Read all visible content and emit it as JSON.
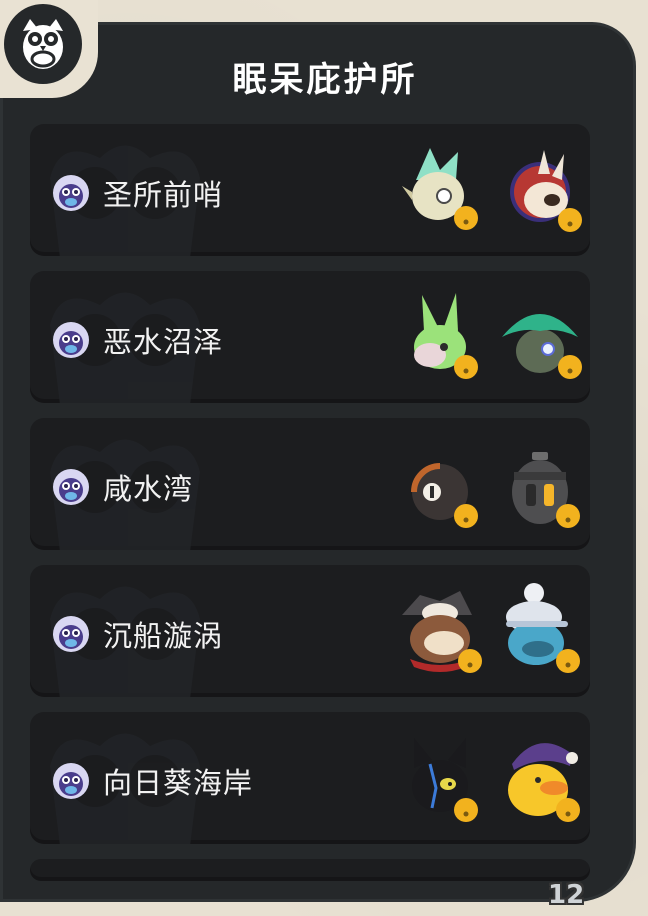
{
  "panel": {
    "title": "眠呆庇护所"
  },
  "locations": [
    {
      "label": "圣所前哨",
      "pets": [
        "crested-bird-pet-icon",
        "rabbit-helmet-pet-icon"
      ]
    },
    {
      "label": "恶水沼泽",
      "pets": [
        "green-bunny-pet-icon",
        "leaf-hat-pet-icon"
      ]
    },
    {
      "label": "咸水湾",
      "pets": [
        "round-ball-pet-icon",
        "lantern-pet-icon"
      ]
    },
    {
      "label": "沉船漩涡",
      "pets": [
        "skull-hat-pet-icon",
        "blue-cloud-pet-icon"
      ]
    },
    {
      "label": "向日葵海岸",
      "pets": [
        "black-cat-pet-icon",
        "yellow-duck-pet-icon"
      ]
    }
  ],
  "footer": {
    "page_counter": "12"
  },
  "colors": {
    "panel": "#25282a",
    "row": "#1c1d1f",
    "paper": "#e8e1d2",
    "bell": "#f2b21e"
  }
}
